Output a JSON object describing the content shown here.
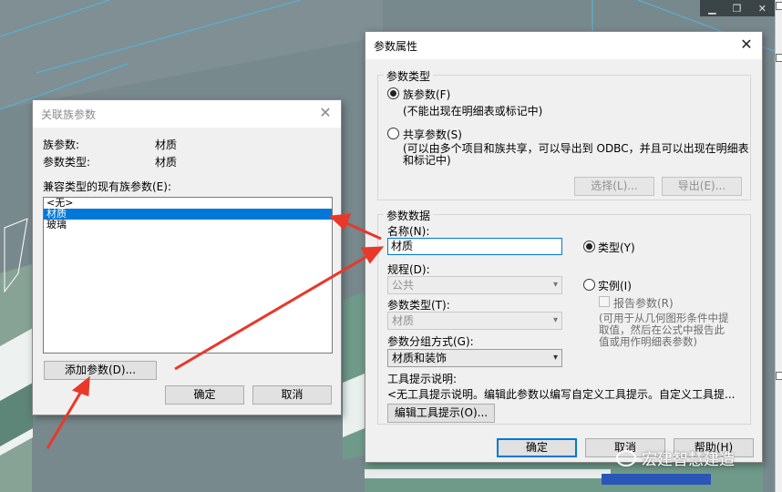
{
  "assoc_dialog": {
    "title": "关联族参数",
    "family_param_label": "族参数:",
    "family_param_value": "材质",
    "param_type_label": "参数类型:",
    "param_type_value": "材质",
    "compatible_label": "兼容类型的现有族参数(E):",
    "list_items": [
      "<无>",
      "材质",
      "玻璃"
    ],
    "selected_index": 1,
    "add_param_button": "添加参数(D)...",
    "ok_button": "确定",
    "cancel_button": "取消"
  },
  "param_dialog": {
    "title": "参数属性",
    "param_type_group": "参数类型",
    "family_param_radio": "族参数(F)",
    "family_param_desc": "(不能出现在明细表或标记中)",
    "shared_param_radio": "共享参数(S)",
    "shared_param_desc_1": "(可以由多个项目和族共享，可以导出到 ODBC，并且可以出现在明细表",
    "shared_param_desc_2": "和标记中)",
    "select_button": "选择(L)...",
    "export_button": "导出(E)...",
    "param_data_group": "参数数据",
    "name_label": "名称(N):",
    "name_value": "材质",
    "type_radio": "类型(Y)",
    "instance_radio": "实例(I)",
    "discipline_label": "规程(D):",
    "discipline_value": "公共",
    "param_type_label": "参数类型(T):",
    "param_type_value": "材质",
    "group_by_label": "参数分组方式(G):",
    "group_by_value": "材质和装饰",
    "report_param": "报告参数(R)",
    "report_desc_1": "(可用于从几何图形条件中提",
    "report_desc_2": "取值，然后在公式中报告此",
    "report_desc_3": "值或用作明细表参数)",
    "tooltip_label": "工具提示说明:",
    "tooltip_value": "<无工具提示说明。编辑此参数以编写自定义工具提示。自定义工具提...",
    "edit_tooltip_button": "编辑工具提示(O)...",
    "ok_button": "确定",
    "cancel_button": "取消",
    "help_button": "帮助(H)"
  },
  "watermark": "宏建智慧建造",
  "colors": {
    "accent": "#0078d7",
    "arrow": "#e8382a",
    "slab": "#6f9a8a"
  }
}
